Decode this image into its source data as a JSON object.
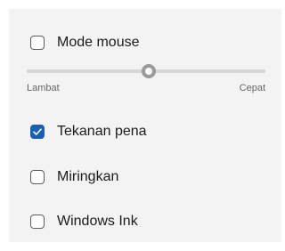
{
  "pen_settings": {
    "mouse_mode": {
      "label": "Mode mouse",
      "checked": false
    },
    "speed": {
      "min_label": "Lambat",
      "max_label": "Cepat",
      "value_fraction": 0.51
    },
    "pen_pressure": {
      "label": "Tekanan pena",
      "checked": true
    },
    "tilt": {
      "label": "Miringkan",
      "checked": false
    },
    "windows_ink": {
      "label": "Windows Ink",
      "checked": false
    }
  },
  "colors": {
    "accent": "#1a5fb4",
    "panel_bg": "#f3f3f3"
  }
}
